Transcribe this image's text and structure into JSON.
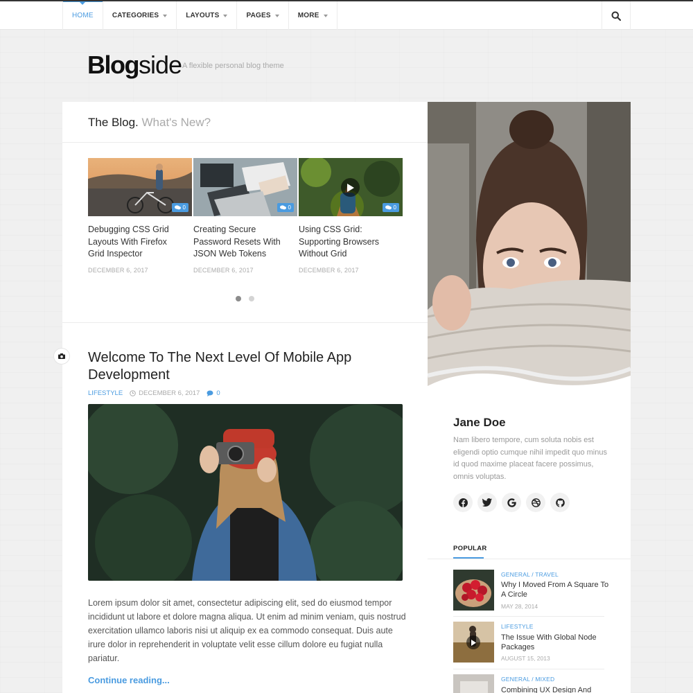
{
  "nav": {
    "items": [
      {
        "label": "HOME"
      },
      {
        "label": "CATEGORIES"
      },
      {
        "label": "LAYOUTS"
      },
      {
        "label": "PAGES"
      },
      {
        "label": "MORE"
      }
    ],
    "search_icon": "search-icon"
  },
  "brand": {
    "logo_bold": "Blog",
    "logo_light": "side",
    "tagline": "A flexible personal blog theme"
  },
  "blog_section": {
    "title": "The Blog.",
    "subtitle": "What's New?",
    "slides": [
      {
        "title": "Debugging CSS Grid Layouts With Firefox Grid Inspector",
        "date": "DECEMBER 6, 2017",
        "comments": "0"
      },
      {
        "title": "Creating Secure Password Resets With JSON Web Tokens",
        "date": "DECEMBER 6, 2017",
        "comments": "0"
      },
      {
        "title": "Using CSS Grid: Supporting Browsers Without Grid",
        "date": "DECEMBER 6, 2017",
        "comments": "0"
      }
    ]
  },
  "post": {
    "title": "Welcome To The Next Level Of Mobile App Development",
    "category": "LIFESTYLE",
    "date": "DECEMBER 6, 2017",
    "comments": "0",
    "excerpt": "Lorem ipsum dolor sit amet, consectetur adipiscing elit, sed do eiusmod tempor incididunt ut labore et dolore magna aliqua. Ut enim ad minim veniam, quis nostrud exercitation ullamco laboris nisi ut aliquip ex ea commodo consequat. Duis aute irure dolor in reprehenderit in voluptate velit esse cillum dolore eu fugiat nulla pariatur.",
    "read_more": "Continue reading..."
  },
  "sidebar": {
    "name": "Jane Doe",
    "bio": "Nam libero tempore, cum soluta nobis est eligendi optio cumque nihil impedit quo minus id quod maxime placeat facere possimus, omnis voluptas.",
    "socials": [
      {
        "icon": "facebook-icon",
        "glyph": "f"
      },
      {
        "icon": "twitter-icon",
        "glyph": "t"
      },
      {
        "icon": "google-icon",
        "glyph": "G"
      },
      {
        "icon": "dribbble-icon",
        "glyph": "d"
      },
      {
        "icon": "github-icon",
        "glyph": "g"
      }
    ],
    "popular_label": "POPULAR",
    "popular": [
      {
        "category": "GENERAL / TRAVEL",
        "title": "Why I Moved From A Square To A Circle",
        "date": "MAY 28, 2014"
      },
      {
        "category": "LIFESTYLE",
        "title": "The Issue With Global Node Packages",
        "date": "AUGUST 15, 2013"
      },
      {
        "category": "GENERAL / MIXED",
        "title": "Combining UX Design And",
        "date": ""
      }
    ]
  },
  "colors": {
    "accent": "#4a9be0",
    "text_dark": "#222222",
    "text_muted": "#aaaaaa"
  }
}
